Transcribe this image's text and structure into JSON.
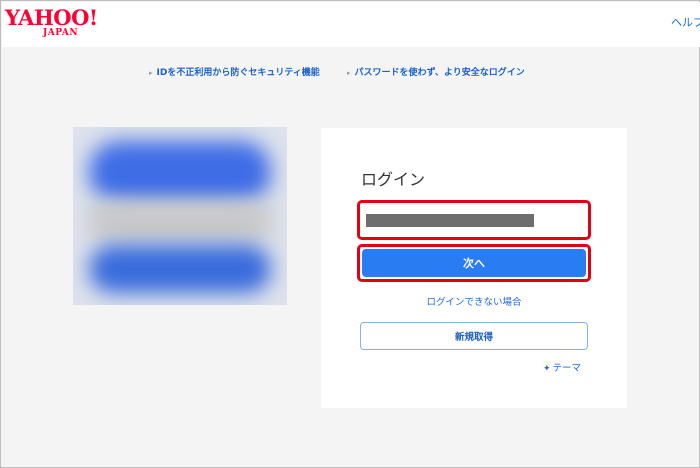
{
  "header": {
    "logo_main": "YAHOO!",
    "logo_sub": "JAPAN",
    "help_label": "ヘルプ"
  },
  "promos": [
    {
      "label": "IDを不正利用から防ぐセキュリティ機能"
    },
    {
      "label": "パスワードを使わず、より安全なログイン"
    }
  ],
  "login": {
    "title": "ログイン",
    "id_field_value": "",
    "next_label": "次へ",
    "cant_login_label": "ログインできない場合",
    "register_label": "新規取得",
    "theme_label": "テーマ",
    "theme_icon": "magic-wand-icon"
  },
  "colors": {
    "brand_red": "#ff0033",
    "link_blue": "#1e6bd6",
    "primary_button": "#2a7cf2",
    "highlight_outline": "#e20012"
  }
}
